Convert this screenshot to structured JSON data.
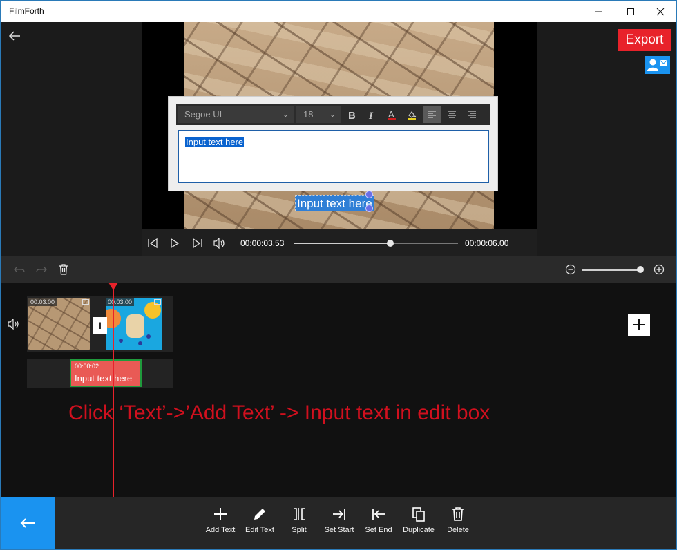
{
  "window": {
    "title": "FilmForth",
    "minimize_icon": "minimize-icon",
    "maximize_icon": "maximize-icon",
    "close_icon": "close-icon"
  },
  "header": {
    "export_label": "Export",
    "account_icon": "account-mail-icon"
  },
  "editor": {
    "font_family": "Segoe UI",
    "font_size": "18",
    "text_value": "Input text here",
    "buttons": [
      "bold-icon",
      "italic-icon",
      "font-color-icon",
      "fill-color-icon",
      "align-left-icon",
      "align-center-icon",
      "align-right-icon"
    ]
  },
  "preview": {
    "overlay_text": "Input text here"
  },
  "playback": {
    "current_time": "00:00:03.53",
    "total_time": "00:00:06.00",
    "progress": 0.59
  },
  "timeline": {
    "zoom_level": 0.95,
    "clips": [
      {
        "duration": "00:03.00"
      },
      {
        "duration": "00:03.00"
      }
    ],
    "transition_label": "I",
    "text_clip": {
      "time": "00:00:02",
      "label": "Input text here"
    },
    "instruction": "Click ‘Text’->’Add Text’ -> Input text in edit box"
  },
  "toolbar": {
    "tools": [
      {
        "label": "Add Text",
        "icon": "plus-icon"
      },
      {
        "label": "Edit Text",
        "icon": "pencil-icon"
      },
      {
        "label": "Split",
        "icon": "split-icon"
      },
      {
        "label": "Set Start",
        "icon": "set-start-icon"
      },
      {
        "label": "Set End",
        "icon": "set-end-icon"
      },
      {
        "label": "Duplicate",
        "icon": "duplicate-icon"
      },
      {
        "label": "Delete",
        "icon": "trash-icon"
      }
    ]
  },
  "colors": {
    "accent_blue": "#1a93f0",
    "export_red": "#e8222a",
    "playhead_red": "#e8222a",
    "text_clip": "#e95a55",
    "instruction_red": "#d0101e"
  }
}
